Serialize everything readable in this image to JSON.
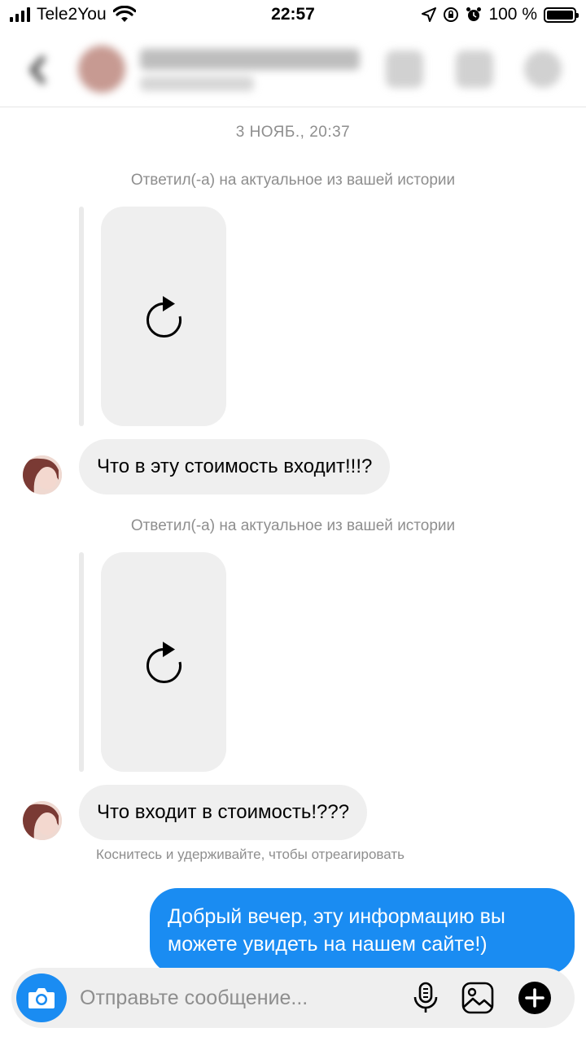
{
  "status_bar": {
    "carrier": "Tele2You",
    "time": "22:57",
    "battery": "100 %"
  },
  "conversation": {
    "timestamp": "3 НОЯБ., 20:37",
    "reply_note_1": "Ответил(-а) на актуальное из вашей истории",
    "message_1": "Что в эту стоимость входит!!!?",
    "reply_note_2": "Ответил(-а) на актуальное из вашей истории",
    "message_2": "Что входит в стоимость!???",
    "react_hint": "Коснитесь и удерживайте, чтобы отреагировать",
    "sent_message": "Добрый вечер, эту информацию вы можете увидеть на нашем сайте!)"
  },
  "composer": {
    "placeholder": "Отправьте сообщение..."
  },
  "icons": {
    "camera": "camera-icon",
    "microphone": "microphone-icon",
    "gallery": "gallery-icon",
    "add": "plus-circle-icon",
    "reload": "reload-icon"
  },
  "colors": {
    "accent_blue": "#1a8cf2",
    "bubble_gray": "#efefef",
    "secondary_text": "#8e8e8e"
  }
}
